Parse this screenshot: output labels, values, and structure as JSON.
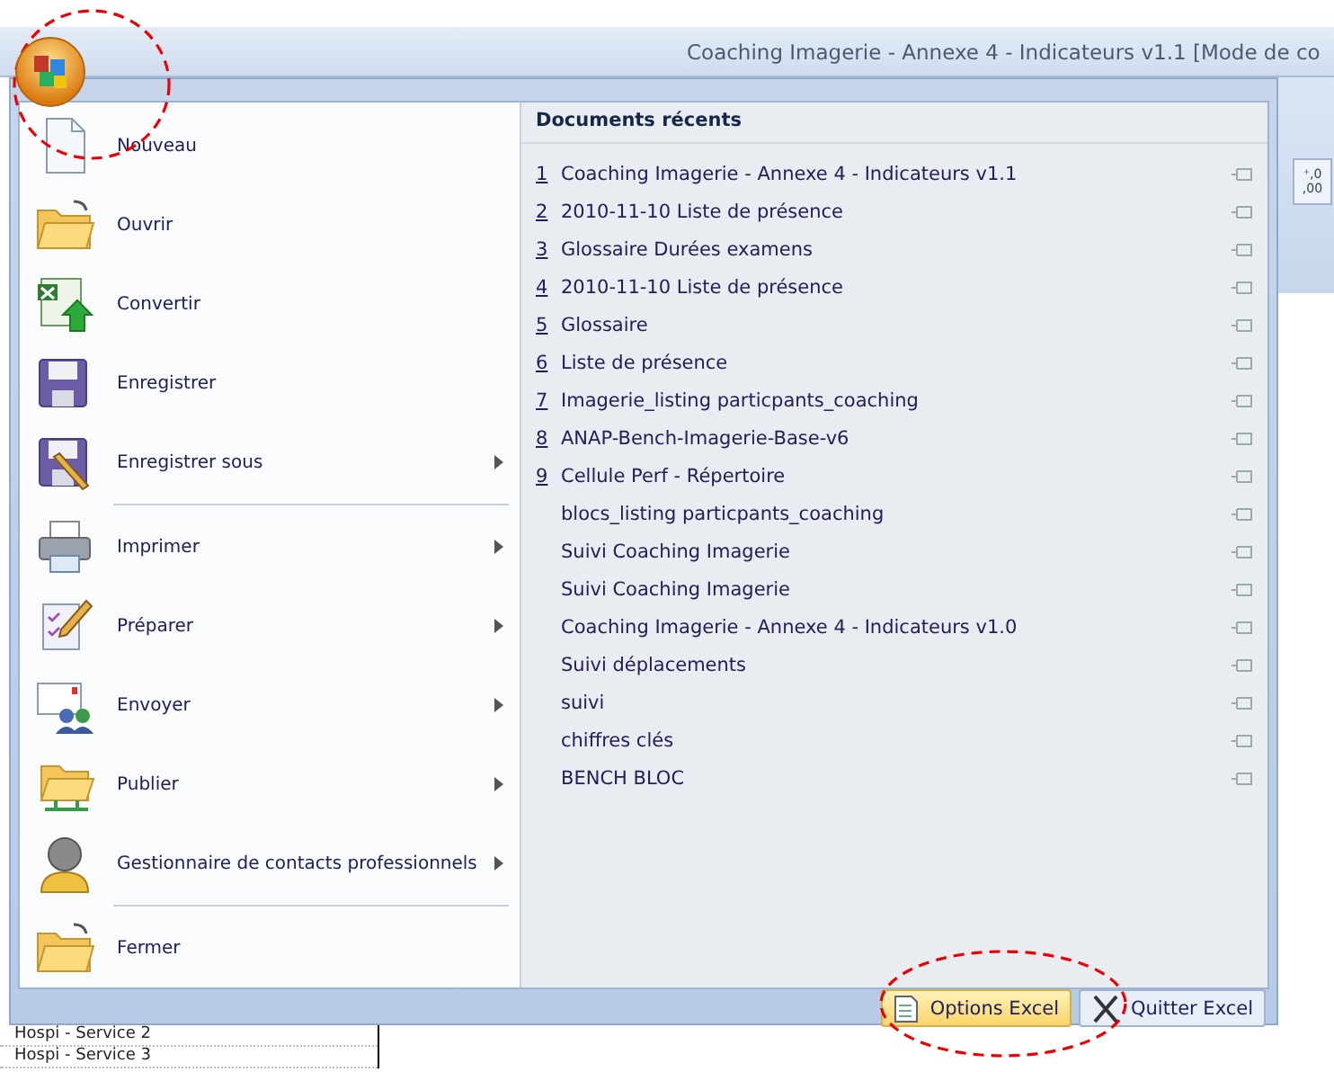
{
  "window": {
    "title": "Coaching Imagerie - Annexe 4 - Indicateurs v1.1  [Mode de co"
  },
  "menu": {
    "groups": [
      [
        {
          "label": "Nouveau",
          "has_submenu": false
        },
        {
          "label": "Ouvrir",
          "has_submenu": false
        },
        {
          "label": "Convertir",
          "has_submenu": false
        },
        {
          "label": "Enregistrer",
          "has_submenu": false
        },
        {
          "label": "Enregistrer sous",
          "has_submenu": true
        }
      ],
      [
        {
          "label": "Imprimer",
          "has_submenu": true
        },
        {
          "label": "Préparer",
          "has_submenu": true
        },
        {
          "label": "Envoyer",
          "has_submenu": true
        },
        {
          "label": "Publier",
          "has_submenu": true
        },
        {
          "label": "Gestionnaire de contacts professionnels",
          "has_submenu": true
        }
      ],
      [
        {
          "label": "Fermer",
          "has_submenu": false
        }
      ]
    ]
  },
  "recent": {
    "heading": "Documents récents",
    "items": [
      {
        "number": "1",
        "name": "Coaching Imagerie - Annexe 4 - Indicateurs v1.1"
      },
      {
        "number": "2",
        "name": "2010-11-10  Liste de présence"
      },
      {
        "number": "3",
        "name": "Glossaire Durées examens"
      },
      {
        "number": "4",
        "name": "2010-11-10  Liste de présence"
      },
      {
        "number": "5",
        "name": "Glossaire"
      },
      {
        "number": "6",
        "name": "Liste de présence"
      },
      {
        "number": "7",
        "name": "Imagerie_listing particpants_coaching"
      },
      {
        "number": "8",
        "name": "ANAP-Bench-Imagerie-Base-v6"
      },
      {
        "number": "9",
        "name": "Cellule Perf - Répertoire"
      },
      {
        "name": "blocs_listing particpants_coaching"
      },
      {
        "name": "Suivi Coaching Imagerie"
      },
      {
        "name": "Suivi Coaching Imagerie"
      },
      {
        "name": "Coaching Imagerie - Annexe 4 - Indicateurs v1.0"
      },
      {
        "name": "Suivi déplacements"
      },
      {
        "name": "suivi"
      },
      {
        "name": "chiffres clés"
      },
      {
        "name": "BENCH BLOC"
      }
    ]
  },
  "footer_buttons": [
    {
      "label": "Options Excel",
      "highlighted": true
    },
    {
      "label": "Quitter Excel",
      "highlighted": false
    }
  ],
  "ribbon_fragment": {
    "button_label": "⁺,0 ,00"
  },
  "sheet_rows": [
    "Hospi - Service 2",
    "Hospi - Service 3"
  ]
}
